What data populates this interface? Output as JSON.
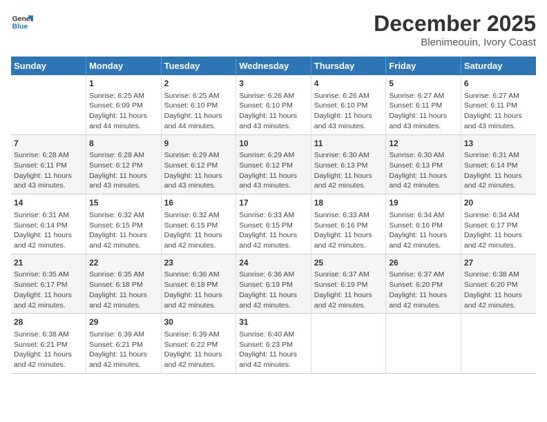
{
  "header": {
    "logo_line1": "General",
    "logo_line2": "Blue",
    "month": "December 2025",
    "location": "Blenimeouin, Ivory Coast"
  },
  "days_of_week": [
    "Sunday",
    "Monday",
    "Tuesday",
    "Wednesday",
    "Thursday",
    "Friday",
    "Saturday"
  ],
  "weeks": [
    [
      {
        "day": "",
        "sunrise": "",
        "sunset": "",
        "daylight": ""
      },
      {
        "day": "1",
        "sunrise": "Sunrise: 6:25 AM",
        "sunset": "Sunset: 6:09 PM",
        "daylight": "Daylight: 11 hours and 44 minutes."
      },
      {
        "day": "2",
        "sunrise": "Sunrise: 6:25 AM",
        "sunset": "Sunset: 6:10 PM",
        "daylight": "Daylight: 11 hours and 44 minutes."
      },
      {
        "day": "3",
        "sunrise": "Sunrise: 6:26 AM",
        "sunset": "Sunset: 6:10 PM",
        "daylight": "Daylight: 11 hours and 43 minutes."
      },
      {
        "day": "4",
        "sunrise": "Sunrise: 6:26 AM",
        "sunset": "Sunset: 6:10 PM",
        "daylight": "Daylight: 11 hours and 43 minutes."
      },
      {
        "day": "5",
        "sunrise": "Sunrise: 6:27 AM",
        "sunset": "Sunset: 6:11 PM",
        "daylight": "Daylight: 11 hours and 43 minutes."
      },
      {
        "day": "6",
        "sunrise": "Sunrise: 6:27 AM",
        "sunset": "Sunset: 6:11 PM",
        "daylight": "Daylight: 11 hours and 43 minutes."
      }
    ],
    [
      {
        "day": "7",
        "sunrise": "Sunrise: 6:28 AM",
        "sunset": "Sunset: 6:11 PM",
        "daylight": "Daylight: 11 hours and 43 minutes."
      },
      {
        "day": "8",
        "sunrise": "Sunrise: 6:28 AM",
        "sunset": "Sunset: 6:12 PM",
        "daylight": "Daylight: 11 hours and 43 minutes."
      },
      {
        "day": "9",
        "sunrise": "Sunrise: 6:29 AM",
        "sunset": "Sunset: 6:12 PM",
        "daylight": "Daylight: 11 hours and 43 minutes."
      },
      {
        "day": "10",
        "sunrise": "Sunrise: 6:29 AM",
        "sunset": "Sunset: 6:12 PM",
        "daylight": "Daylight: 11 hours and 43 minutes."
      },
      {
        "day": "11",
        "sunrise": "Sunrise: 6:30 AM",
        "sunset": "Sunset: 6:13 PM",
        "daylight": "Daylight: 11 hours and 42 minutes."
      },
      {
        "day": "12",
        "sunrise": "Sunrise: 6:30 AM",
        "sunset": "Sunset: 6:13 PM",
        "daylight": "Daylight: 11 hours and 42 minutes."
      },
      {
        "day": "13",
        "sunrise": "Sunrise: 6:31 AM",
        "sunset": "Sunset: 6:14 PM",
        "daylight": "Daylight: 11 hours and 42 minutes."
      }
    ],
    [
      {
        "day": "14",
        "sunrise": "Sunrise: 6:31 AM",
        "sunset": "Sunset: 6:14 PM",
        "daylight": "Daylight: 11 hours and 42 minutes."
      },
      {
        "day": "15",
        "sunrise": "Sunrise: 6:32 AM",
        "sunset": "Sunset: 6:15 PM",
        "daylight": "Daylight: 11 hours and 42 minutes."
      },
      {
        "day": "16",
        "sunrise": "Sunrise: 6:32 AM",
        "sunset": "Sunset: 6:15 PM",
        "daylight": "Daylight: 11 hours and 42 minutes."
      },
      {
        "day": "17",
        "sunrise": "Sunrise: 6:33 AM",
        "sunset": "Sunset: 6:15 PM",
        "daylight": "Daylight: 11 hours and 42 minutes."
      },
      {
        "day": "18",
        "sunrise": "Sunrise: 6:33 AM",
        "sunset": "Sunset: 6:16 PM",
        "daylight": "Daylight: 11 hours and 42 minutes."
      },
      {
        "day": "19",
        "sunrise": "Sunrise: 6:34 AM",
        "sunset": "Sunset: 6:16 PM",
        "daylight": "Daylight: 11 hours and 42 minutes."
      },
      {
        "day": "20",
        "sunrise": "Sunrise: 6:34 AM",
        "sunset": "Sunset: 6:17 PM",
        "daylight": "Daylight: 11 hours and 42 minutes."
      }
    ],
    [
      {
        "day": "21",
        "sunrise": "Sunrise: 6:35 AM",
        "sunset": "Sunset: 6:17 PM",
        "daylight": "Daylight: 11 hours and 42 minutes."
      },
      {
        "day": "22",
        "sunrise": "Sunrise: 6:35 AM",
        "sunset": "Sunset: 6:18 PM",
        "daylight": "Daylight: 11 hours and 42 minutes."
      },
      {
        "day": "23",
        "sunrise": "Sunrise: 6:36 AM",
        "sunset": "Sunset: 6:18 PM",
        "daylight": "Daylight: 11 hours and 42 minutes."
      },
      {
        "day": "24",
        "sunrise": "Sunrise: 6:36 AM",
        "sunset": "Sunset: 6:19 PM",
        "daylight": "Daylight: 11 hours and 42 minutes."
      },
      {
        "day": "25",
        "sunrise": "Sunrise: 6:37 AM",
        "sunset": "Sunset: 6:19 PM",
        "daylight": "Daylight: 11 hours and 42 minutes."
      },
      {
        "day": "26",
        "sunrise": "Sunrise: 6:37 AM",
        "sunset": "Sunset: 6:20 PM",
        "daylight": "Daylight: 11 hours and 42 minutes."
      },
      {
        "day": "27",
        "sunrise": "Sunrise: 6:38 AM",
        "sunset": "Sunset: 6:20 PM",
        "daylight": "Daylight: 11 hours and 42 minutes."
      }
    ],
    [
      {
        "day": "28",
        "sunrise": "Sunrise: 6:38 AM",
        "sunset": "Sunset: 6:21 PM",
        "daylight": "Daylight: 11 hours and 42 minutes."
      },
      {
        "day": "29",
        "sunrise": "Sunrise: 6:39 AM",
        "sunset": "Sunset: 6:21 PM",
        "daylight": "Daylight: 11 hours and 42 minutes."
      },
      {
        "day": "30",
        "sunrise": "Sunrise: 6:39 AM",
        "sunset": "Sunset: 6:22 PM",
        "daylight": "Daylight: 11 hours and 42 minutes."
      },
      {
        "day": "31",
        "sunrise": "Sunrise: 6:40 AM",
        "sunset": "Sunset: 6:23 PM",
        "daylight": "Daylight: 11 hours and 42 minutes."
      },
      {
        "day": "",
        "sunrise": "",
        "sunset": "",
        "daylight": ""
      },
      {
        "day": "",
        "sunrise": "",
        "sunset": "",
        "daylight": ""
      },
      {
        "day": "",
        "sunrise": "",
        "sunset": "",
        "daylight": ""
      }
    ]
  ]
}
